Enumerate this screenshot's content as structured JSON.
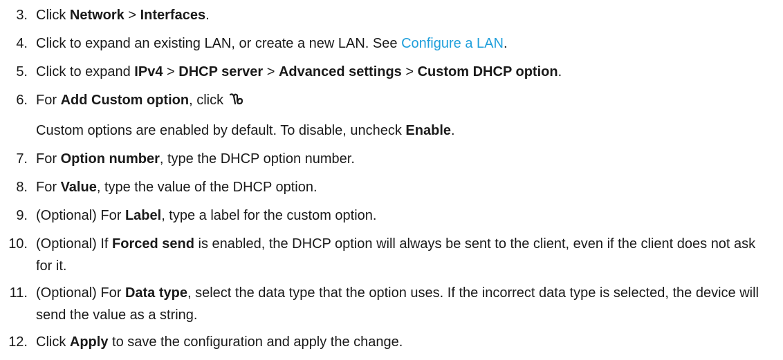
{
  "steps": [
    {
      "num": "3.",
      "parts": [
        "Click ",
        "Network",
        " > ",
        "Interfaces",
        "."
      ]
    },
    {
      "num": "4.",
      "parts": [
        "Click to expand an existing LAN, or create a new LAN. See ",
        "Configure a LAN",
        "."
      ]
    },
    {
      "num": "5.",
      "parts": [
        "Click to expand ",
        "IPv4",
        " > ",
        "DHCP server",
        " > ",
        "Advanced settings",
        " > ",
        "Custom DHCP option",
        "."
      ]
    },
    {
      "num": "6.",
      "parts": [
        "For ",
        "Add Custom option",
        ", click "
      ],
      "icon": "add-icon",
      "sub": [
        "Custom options are enabled by default. To disable, uncheck ",
        "Enable",
        "."
      ]
    },
    {
      "num": "7.",
      "parts": [
        "For ",
        "Option number",
        ", type the DHCP option number."
      ]
    },
    {
      "num": "8.",
      "parts": [
        "For ",
        "Value",
        ", type the value of the DHCP option."
      ]
    },
    {
      "num": "9.",
      "parts": [
        "(Optional) For ",
        "Label",
        ", type a label for the custom option."
      ]
    },
    {
      "num": "10.",
      "parts": [
        "(Optional) If ",
        "Forced send",
        " is enabled, the DHCP option will always be sent to the client, even if the client does not ask for it."
      ]
    },
    {
      "num": "11.",
      "parts": [
        "(Optional) For ",
        "Data type",
        ", select the data type that the option uses. If the incorrect data type is selected, the device will send the value as a string."
      ]
    },
    {
      "num": "12.",
      "parts": [
        "Click ",
        "Apply",
        " to save the configuration and apply the change."
      ]
    }
  ],
  "colors": {
    "link": "#1f9fdb",
    "text": "#1a1a1a"
  }
}
